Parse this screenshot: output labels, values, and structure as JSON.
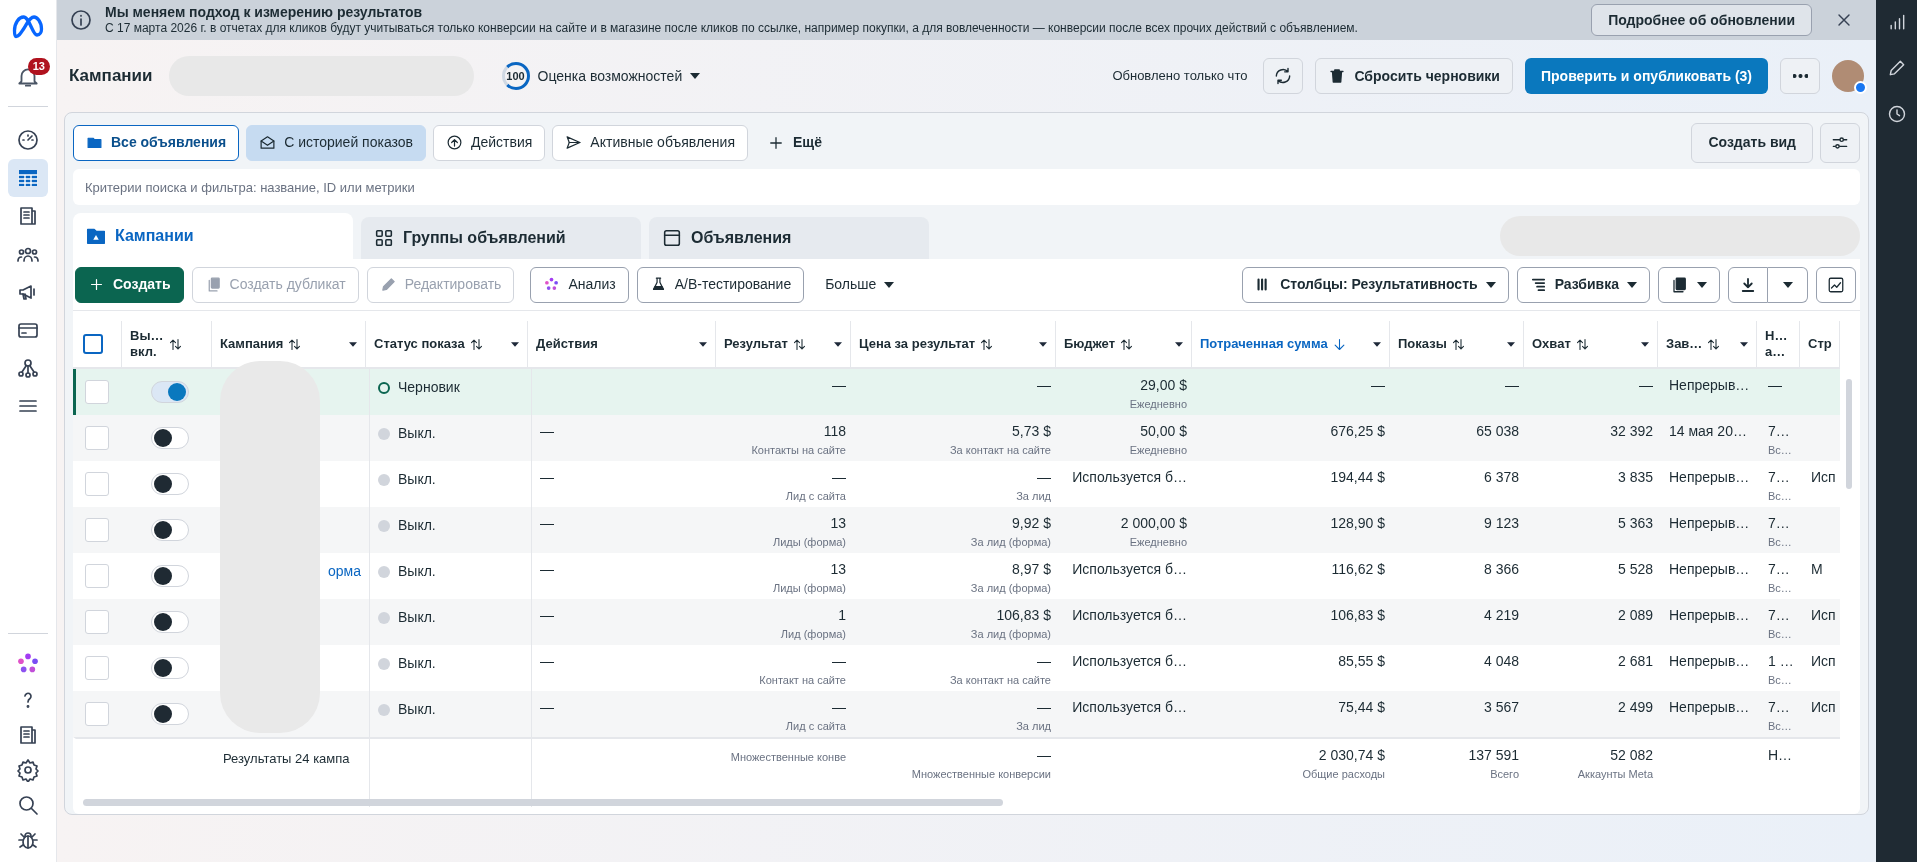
{
  "banner": {
    "title": "Мы меняем подход к измерению результатов",
    "text": "С 17 марта 2026 г. в отчетах для кликов будут учитываться только конверсии на сайте и в магазине после кликов по ссылке, например покупки, а для вовлеченности — конверсии после всех прочих действий с объявлением.",
    "button": "Подробнее об обновлении"
  },
  "sidebar": {
    "notification_badge": "13",
    "items": [
      {
        "selected": false
      },
      {
        "selected": true
      },
      {
        "selected": false
      },
      {
        "selected": false
      },
      {
        "selected": false
      },
      {
        "selected": false
      },
      {
        "selected": false
      },
      {
        "selected": false
      }
    ]
  },
  "header": {
    "title": "Кампании",
    "score": "100",
    "score_label": "Оценка возможностей",
    "updated": "Обновлено только что",
    "discard_button": "Сбросить черновики",
    "publish_button": "Проверить и опубликовать (3)"
  },
  "view_tabs": [
    {
      "label": "Все объявления",
      "selected": true,
      "highlighted": false
    },
    {
      "label": "С историей показов",
      "selected": false,
      "highlighted": true
    },
    {
      "label": "Действия",
      "selected": false,
      "highlighted": false
    },
    {
      "label": "Активные объявления",
      "selected": false,
      "highlighted": false
    }
  ],
  "more_views": "Ещё",
  "create_view_button": "Создать вид",
  "search": {
    "placeholder": "Критерии поиска и фильтра: название, ID или метрики"
  },
  "level_tabs": [
    {
      "label": "Кампании",
      "selected": true
    },
    {
      "label": "Группы объявлений",
      "selected": false
    },
    {
      "label": "Объявления",
      "selected": false
    }
  ],
  "toolbar": [
    {
      "label": "Создать",
      "kind": "primary"
    },
    {
      "label": "Создать дубликат",
      "kind": "disabled"
    },
    {
      "label": "Редактировать",
      "kind": "disabled"
    },
    {
      "label": "Анализ",
      "kind": "default"
    },
    {
      "label": "A/B-тестирование",
      "kind": "default"
    },
    {
      "label": "Больше",
      "kind": "menu"
    }
  ],
  "columns_button": "Столбцы: Результативность",
  "breakdown_button": "Разбивка",
  "table": {
    "select_all": {
      "checked": false
    },
    "columns": [
      {
        "label": "Вы…\nвкл.",
        "sortable": true,
        "sorted": false,
        "menu": false
      },
      {
        "label": "Кампания",
        "sortable": true,
        "sorted": false,
        "menu": true
      },
      {
        "label": "Статус показа",
        "sortable": true,
        "sorted": false,
        "menu": true
      },
      {
        "label": "Действия",
        "sortable": false,
        "sorted": false,
        "menu": true
      },
      {
        "label": "Результат",
        "sortable": true,
        "sorted": false,
        "menu": true
      },
      {
        "label": "Цена за результат",
        "sortable": true,
        "sorted": false,
        "menu": true
      },
      {
        "label": "Бюджет",
        "sortable": true,
        "sorted": false,
        "menu": true
      },
      {
        "label": "Потраченная сумма",
        "sortable": true,
        "sorted": true,
        "menu": true
      },
      {
        "label": "Показы",
        "sortable": true,
        "sorted": false,
        "menu": true
      },
      {
        "label": "Охват",
        "sortable": true,
        "sorted": false,
        "menu": true
      },
      {
        "label": "Зав…",
        "sortable": true,
        "sorted": false,
        "menu": true
      },
      {
        "label": "Н…\nа…"
      },
      {
        "label": "Стр"
      }
    ],
    "rows": [
      {
        "highlighted": true,
        "checked": false,
        "cells": [
          {
            "on": true
          },
          {},
          {
            "kind": "draft",
            "v": "Черновик"
          },
          {},
          {
            "v": "—"
          },
          {
            "v": "—"
          },
          {
            "v": "29,00 $",
            "s": "Ежедневно"
          },
          {
            "v": "—"
          },
          {
            "v": "—"
          },
          {
            "v": "—"
          },
          {
            "v": "Непрерыв…"
          },
          {
            "v": "—"
          },
          {}
        ]
      },
      {
        "highlighted": false,
        "checked": false,
        "cells": [
          {
            "on": false
          },
          {},
          {
            "kind": "off",
            "v": "Выкл."
          },
          {
            "v": "—"
          },
          {
            "v": "118",
            "s": "Контакты на сайте"
          },
          {
            "v": "5,73 $",
            "s": "За контакт на сайте"
          },
          {
            "v": "50,00 $",
            "s": "Ежедневно"
          },
          {
            "v": "676,25 $"
          },
          {
            "v": "65 038"
          },
          {
            "v": "32 392"
          },
          {
            "v": "14 мая 20…"
          },
          {
            "v": "7…",
            "s": "Вс…"
          },
          {}
        ]
      },
      {
        "highlighted": false,
        "checked": false,
        "cells": [
          {
            "on": false
          },
          {},
          {
            "kind": "off",
            "v": "Выкл."
          },
          {
            "v": "—"
          },
          {
            "v": "—",
            "s": "Лид с сайта"
          },
          {
            "v": "—",
            "s": "За лид"
          },
          {
            "v": "Используется б…"
          },
          {
            "v": "194,44 $"
          },
          {
            "v": "6 378"
          },
          {
            "v": "3 835"
          },
          {
            "v": "Непрерыв…"
          },
          {
            "v": "7…",
            "s": "Вс…"
          },
          {
            "v": "Исп"
          }
        ]
      },
      {
        "highlighted": false,
        "checked": false,
        "cells": [
          {
            "on": false
          },
          {},
          {
            "kind": "off",
            "v": "Выкл."
          },
          {
            "v": "—"
          },
          {
            "v": "13",
            "s": "Лиды (форма)"
          },
          {
            "v": "9,92 $",
            "s": "За лид (форма)"
          },
          {
            "v": "2 000,00 $",
            "s": "Ежедневно"
          },
          {
            "v": "128,90 $"
          },
          {
            "v": "9 123"
          },
          {
            "v": "5 363"
          },
          {
            "v": "Непрерыв…"
          },
          {
            "v": "7…",
            "s": "Вс…"
          },
          {}
        ]
      },
      {
        "highlighted": false,
        "checked": false,
        "cells": [
          {
            "on": false
          },
          {
            "v": "орма"
          },
          {
            "kind": "off",
            "v": "Выкл."
          },
          {
            "v": "—"
          },
          {
            "v": "13",
            "s": "Лиды (форма)"
          },
          {
            "v": "8,97 $",
            "s": "За лид (форма)"
          },
          {
            "v": "Используется б…"
          },
          {
            "v": "116,62 $"
          },
          {
            "v": "8 366"
          },
          {
            "v": "5 528"
          },
          {
            "v": "Непрерыв…"
          },
          {
            "v": "7…",
            "s": "Вс…"
          },
          {
            "v": "М"
          }
        ]
      },
      {
        "highlighted": false,
        "checked": false,
        "cells": [
          {
            "on": false
          },
          {},
          {
            "kind": "off",
            "v": "Выкл."
          },
          {
            "v": "—"
          },
          {
            "v": "1",
            "s": "Лид (форма)"
          },
          {
            "v": "106,83 $",
            "s": "За лид (форма)"
          },
          {
            "v": "Используется б…"
          },
          {
            "v": "106,83 $"
          },
          {
            "v": "4 219"
          },
          {
            "v": "2 089"
          },
          {
            "v": "Непрерыв…"
          },
          {
            "v": "7…",
            "s": "Вс…"
          },
          {
            "v": "Исп"
          }
        ]
      },
      {
        "highlighted": false,
        "checked": false,
        "cells": [
          {
            "on": false
          },
          {},
          {
            "kind": "off",
            "v": "Выкл."
          },
          {
            "v": "—"
          },
          {
            "v": "—",
            "s": "Контакт на сайте"
          },
          {
            "v": "—",
            "s": "За контакт на сайте"
          },
          {
            "v": "Используется б…"
          },
          {
            "v": "85,55 $"
          },
          {
            "v": "4 048"
          },
          {
            "v": "2 681"
          },
          {
            "v": "Непрерыв…"
          },
          {
            "v": "1 …",
            "s": "Вс…"
          },
          {
            "v": "Исп"
          }
        ]
      },
      {
        "highlighted": false,
        "checked": false,
        "cells": [
          {
            "on": false
          },
          {},
          {
            "kind": "off",
            "v": "Выкл."
          },
          {
            "v": "—"
          },
          {
            "v": "—",
            "s": "Лид с сайта"
          },
          {
            "v": "—",
            "s": "За лид"
          },
          {
            "v": "Используется б…"
          },
          {
            "v": "75,44 $"
          },
          {
            "v": "3 567"
          },
          {
            "v": "2 499"
          },
          {
            "v": "Непрерыв…"
          },
          {
            "v": "7…",
            "s": "Вс…"
          },
          {
            "v": "Исп"
          }
        ]
      }
    ],
    "footer": {
      "label": "Результаты 24 кампа",
      "cells": [
        {},
        {
          "s": "Множественные конве"
        },
        {
          "v": "—",
          "s": "Множественные конверсии"
        },
        {},
        {
          "v": "2 030,74 $",
          "s": "Общие расходы"
        },
        {
          "v": "137 591",
          "s": "Всего"
        },
        {
          "v": "52 082",
          "s": "Аккаунты Meta"
        },
        {},
        {
          "v": "Н…"
        },
        {}
      ]
    }
  }
}
